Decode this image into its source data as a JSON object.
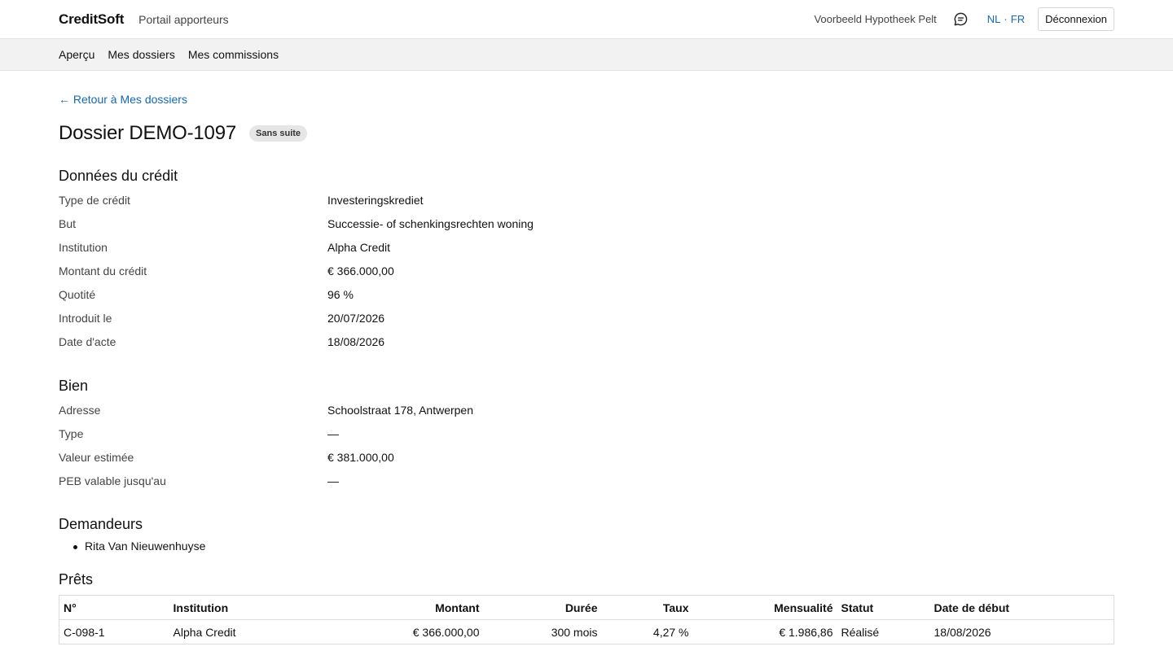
{
  "header": {
    "brand": "CreditSoft",
    "portal": "Portail apporteurs",
    "user": "Voorbeeld Hypotheek Pelt",
    "message_icon": "message-icon",
    "lang_nl": "NL",
    "lang_sep": "·",
    "lang_fr": "FR",
    "logout": "Déconnexion"
  },
  "nav": {
    "items": [
      "Aperçu",
      "Mes dossiers",
      "Mes commissions"
    ]
  },
  "back_link": "← Retour à Mes dossiers",
  "dossier": {
    "title": "Dossier DEMO-1097",
    "status": "Sans suite"
  },
  "credit": {
    "title": "Données du crédit",
    "rows": [
      {
        "label": "Type de crédit",
        "value": "Investeringskrediet"
      },
      {
        "label": "But",
        "value": "Successie- of schenkingsrechten woning"
      },
      {
        "label": "Institution",
        "value": "Alpha Credit"
      },
      {
        "label": "Montant du crédit",
        "value": "€ 366.000,00"
      },
      {
        "label": "Quotité",
        "value": "96 %"
      },
      {
        "label": "Introduit le",
        "value": "20/07/2026"
      },
      {
        "label": "Date d'acte",
        "value": "18/08/2026"
      }
    ]
  },
  "property": {
    "title": "Bien",
    "rows": [
      {
        "label": "Adresse",
        "value": "Schoolstraat 178, Antwerpen"
      },
      {
        "label": "Type",
        "value": "—"
      },
      {
        "label": "Valeur estimée",
        "value": "€ 381.000,00"
      },
      {
        "label": "PEB valable jusqu'au",
        "value": "—"
      }
    ]
  },
  "applicants": {
    "title": "Demandeurs",
    "items": [
      "Rita Van Nieuwenhuyse"
    ]
  },
  "loans": {
    "title": "Prêts",
    "columns": [
      "N°",
      "Institution",
      "Montant",
      "Durée",
      "Taux",
      "Mensualité",
      "Statut",
      "Date de début"
    ],
    "rows": [
      [
        "C-098-1",
        "Alpha Credit",
        "€ 366.000,00",
        "300 mois",
        "4,27 %",
        "€ 1.986,86",
        "Réalisé",
        "18/08/2026"
      ]
    ]
  }
}
